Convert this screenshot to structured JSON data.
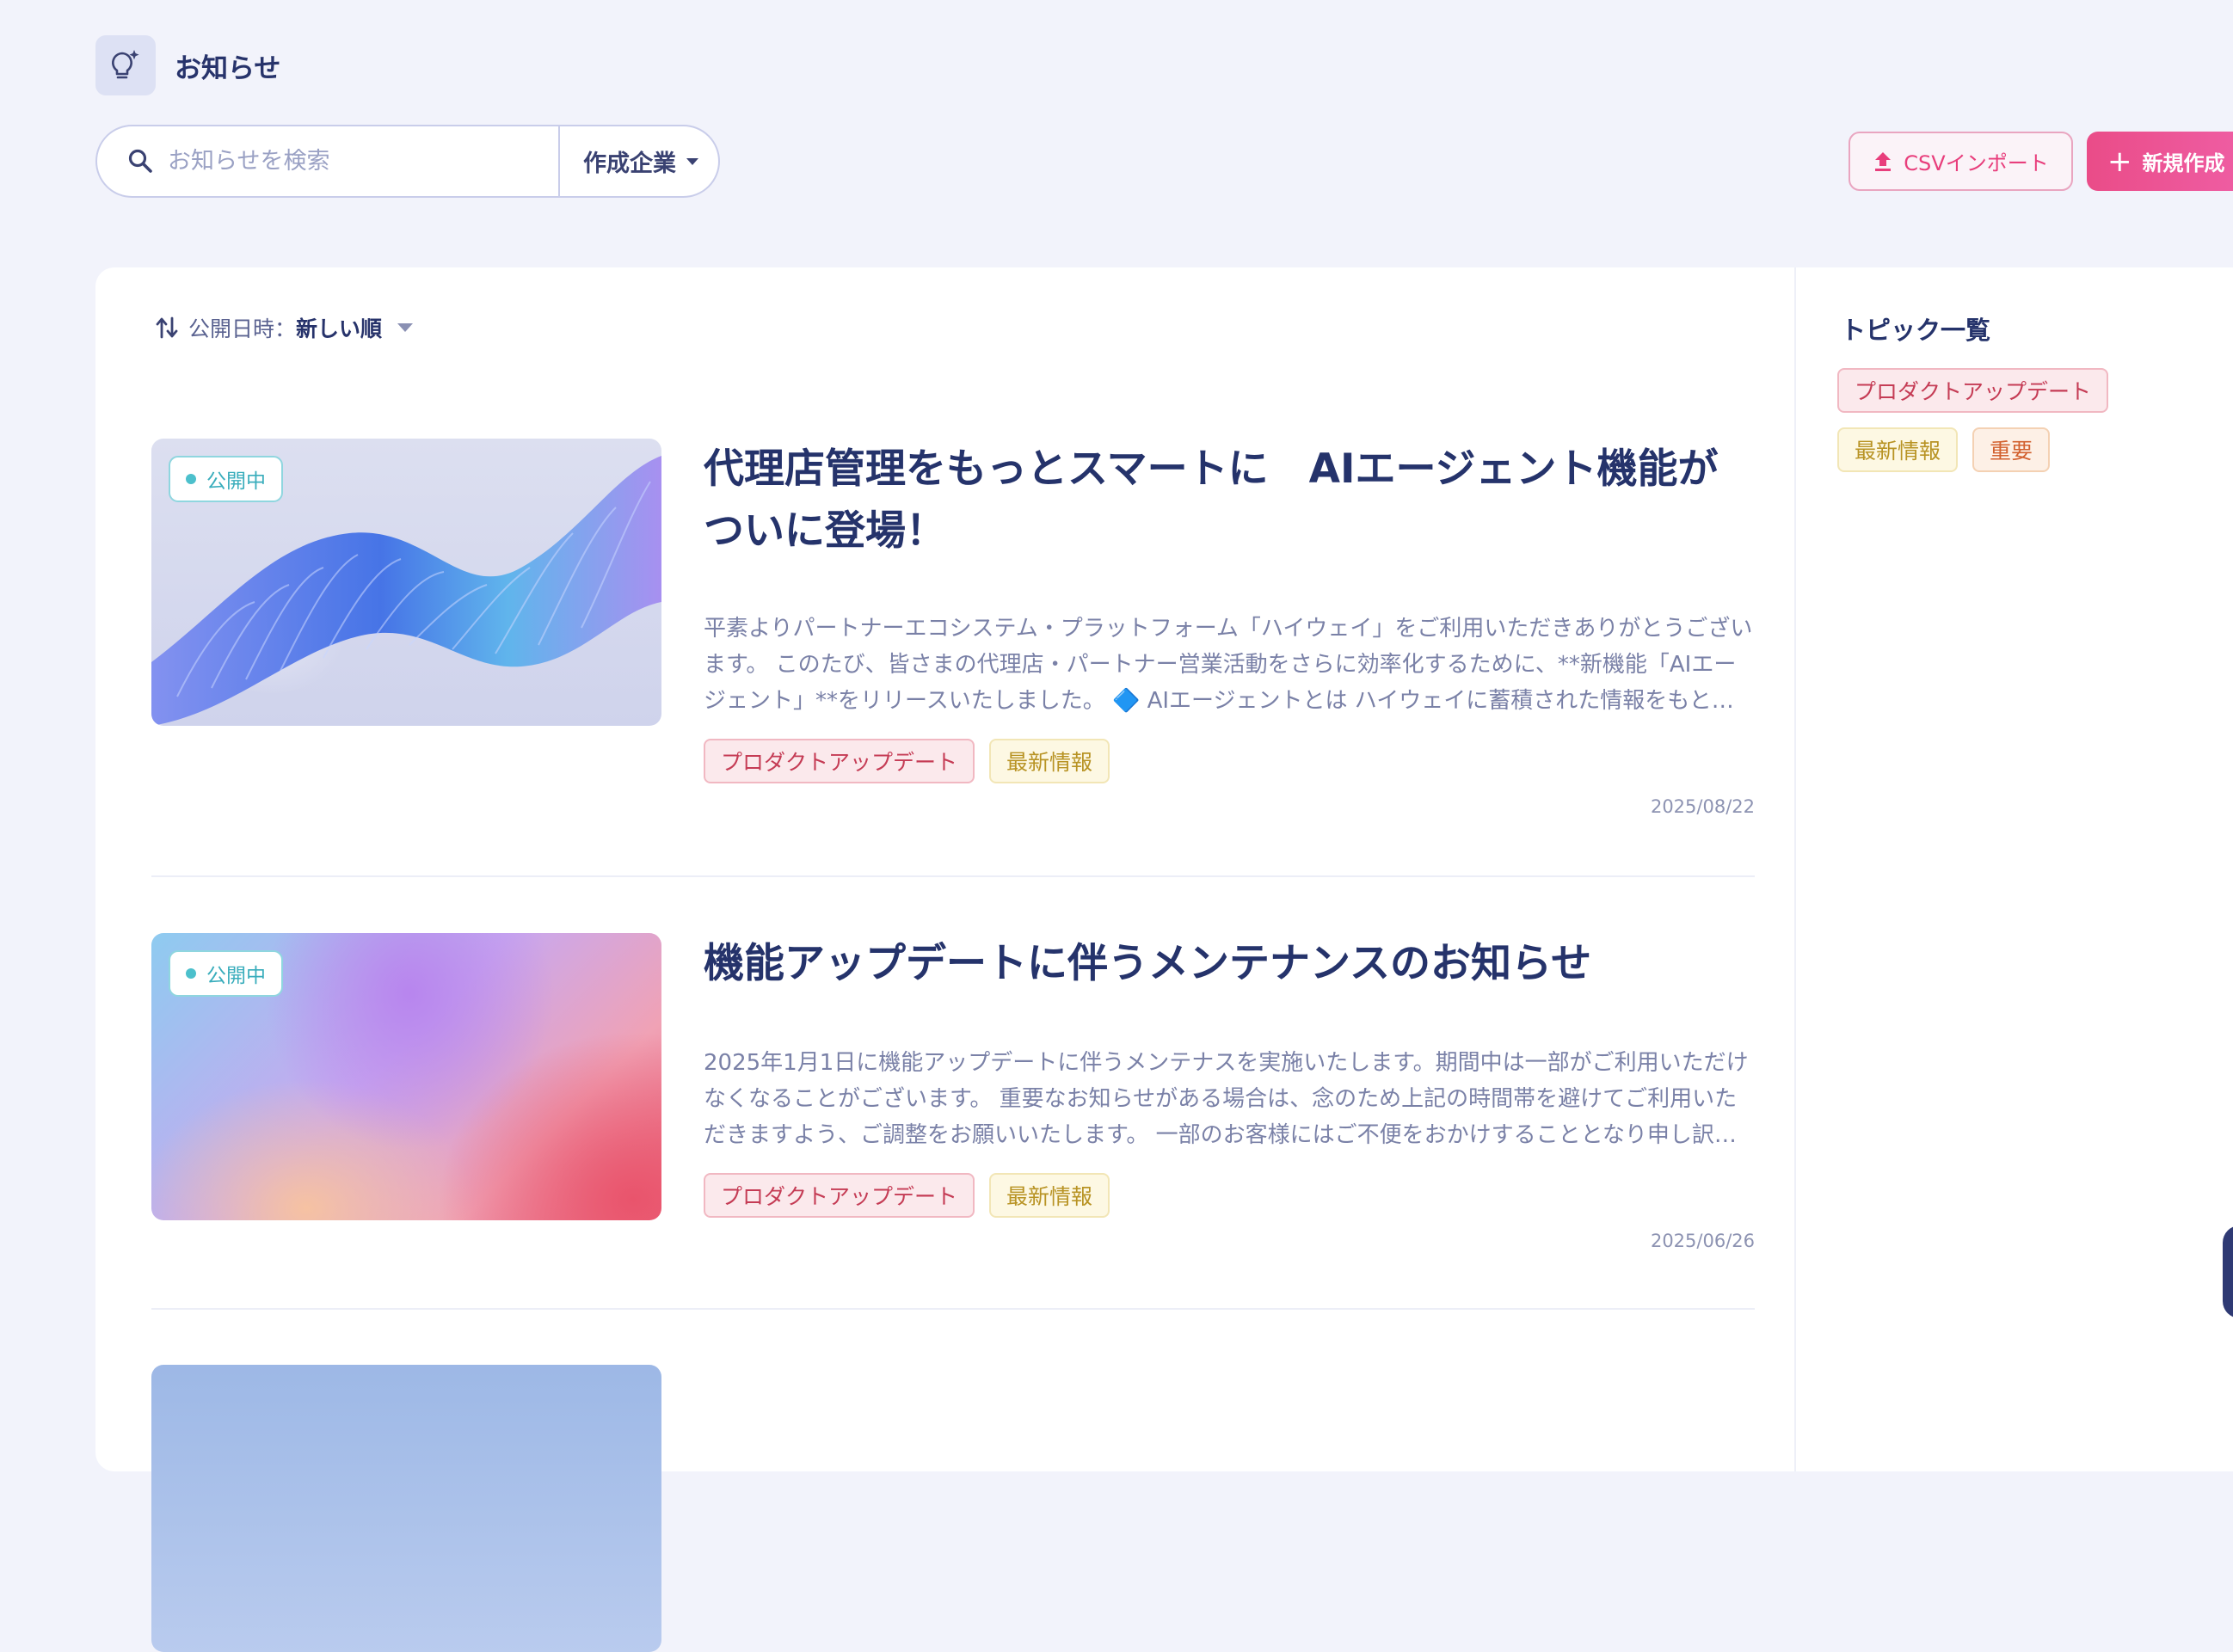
{
  "header": {
    "title": "お知らせ",
    "icon": "lightbulb-sparkle-icon"
  },
  "search": {
    "placeholder": "お知らせを検索",
    "value": ""
  },
  "filter": {
    "company_label": "作成企業"
  },
  "actions": {
    "csv_import_label": "CSVインポート",
    "new_label": "新規作成"
  },
  "sort": {
    "label": "公開日時：",
    "value": "新しい順"
  },
  "items": [
    {
      "status": "公開中",
      "title": "代理店管理をもっとスマートに　AIエージェント機能がついに登場！",
      "excerpt": "平素よりパートナーエコシステム・プラットフォーム「ハイウェイ」をご利用いただきありがとうございます。 このたび、皆さまの代理店・パートナー営業活動をさらに効率化するために、**新機能「AIエージェント」**をリリースいたしました。 🔷 AIエージェントとは ハイウェイに蓄積された情報をもとに、代理店の状況を分析します。",
      "tags": [
        "プロダクトアップデート",
        "最新情報"
      ],
      "date": "2025/08/22"
    },
    {
      "status": "公開中",
      "title": "機能アップデートに伴うメンテナンスのお知らせ",
      "excerpt": "2025年1月1日に機能アップデートに伴うメンテナスを実施いたします。期間中は一部がご利用いただけなくなることがございます。 重要なお知らせがある場合は、念のため上記の時間帯を避けてご利用いただきますよう、ご調整をお願いいたします。 一部のお客様にはご不便をおかけすることとなり申し訳ございません。",
      "tags": [
        "プロダクトアップデート",
        "最新情報"
      ],
      "date": "2025/06/26"
    }
  ],
  "topics": {
    "title": "トピック一覧",
    "items": [
      "プロダクトアップデート",
      "最新情報",
      "重要"
    ]
  },
  "colors": {
    "accent": "#e83e7c",
    "title": "#25336b",
    "background": "#f2f3fb",
    "status": "#39adbc"
  }
}
